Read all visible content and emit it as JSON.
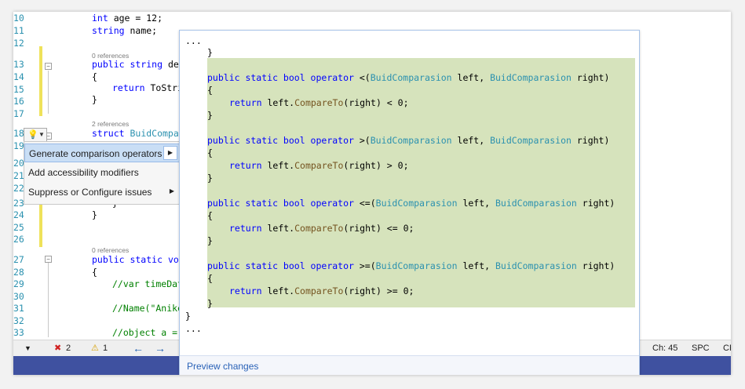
{
  "editor": {
    "line_numbers": [
      "10",
      "11",
      "12",
      "13",
      "14",
      "15",
      "16",
      "17",
      "18",
      "19",
      "20",
      "21",
      "22",
      "23",
      "24",
      "25",
      "26",
      "27",
      "28",
      "29",
      "30",
      "31",
      "32",
      "33"
    ],
    "lines": {
      "l10": [
        "int",
        " age = 12;"
      ],
      "l11": [
        "string",
        " name;"
      ],
      "l13": [
        "public string",
        " debu"
      ],
      "l14": "{",
      "l15": [
        "return ",
        "ToStri"
      ],
      "l16": "}",
      "l18": [
        "struct ",
        "BuidCompar"
      ],
      "l23": "}",
      "l24": "}",
      "l27": [
        "public static",
        " voi"
      ],
      "l28": "{",
      "l29": "//var timeDat",
      "l31": "//Name(\"Anike",
      "l33": "//object a = "
    },
    "refs": {
      "r13": "0 references",
      "r18": "2 references",
      "r27": "0 references"
    }
  },
  "quick_actions": {
    "bulb_icon": "lightbulb-icon",
    "items": [
      {
        "label": "Generate comparison operators",
        "has_submenu": true,
        "selected": true
      },
      {
        "label": "Add accessibility modifiers",
        "has_submenu": false,
        "selected": false
      },
      {
        "label": "Suppress or Configure issues",
        "has_submenu": true,
        "selected": false
      }
    ]
  },
  "preview": {
    "ellipsis_top": "...",
    "closing_brace_1": "}",
    "operators": [
      {
        "sig_kw": "public static bool operator ",
        "op": "<(",
        "type1": "BuidComparasion",
        "p1": " left, ",
        "type2": "BuidComparasion",
        "p2": " right)",
        "body_kw": "return ",
        "body_a": "left.",
        "body_m": "CompareTo",
        "body_b": "(right) < 0;"
      },
      {
        "sig_kw": "public static bool operator ",
        "op": ">(",
        "type1": "BuidComparasion",
        "p1": " left, ",
        "type2": "BuidComparasion",
        "p2": " right)",
        "body_kw": "return ",
        "body_a": "left.",
        "body_m": "CompareTo",
        "body_b": "(right) > 0;"
      },
      {
        "sig_kw": "public static bool operator ",
        "op": "<=(",
        "type1": "BuidComparasion",
        "p1": " left, ",
        "type2": "BuidComparasion",
        "p2": " right)",
        "body_kw": "return ",
        "body_a": "left.",
        "body_m": "CompareTo",
        "body_b": "(right) <= 0;"
      },
      {
        "sig_kw": "public static bool operator ",
        "op": ">=(",
        "type1": "BuidComparasion",
        "p1": " left, ",
        "type2": "BuidComparasion",
        "p2": " right)",
        "body_kw": "return ",
        "body_a": "left.",
        "body_m": "CompareTo",
        "body_b": "(right) >= 0;"
      }
    ],
    "open_brace": "{",
    "close_brace": "}",
    "closing_brace_2": "}",
    "ellipsis_bottom": "...",
    "footer_link": "Preview changes"
  },
  "status_bar": {
    "errors": "2",
    "warnings": "1",
    "error_icon": "error-circle-icon",
    "warning_icon": "warning-triangle-icon",
    "back_icon": "arrow-left-icon",
    "forward_icon": "arrow-right-icon",
    "column": "Ch: 45",
    "spacing": "SPC",
    "line_ending": "CF"
  },
  "colors": {
    "keyword": "#0000ff",
    "type": "#2b91af",
    "comment": "#008000",
    "preview_highlight": "#d6e3bc",
    "bottom_bar": "#3f51a0"
  }
}
